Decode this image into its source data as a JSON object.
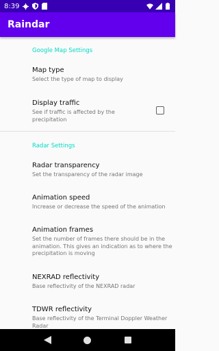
{
  "status_bar": {
    "time": "8:39",
    "icons_left": [
      "gear-icon",
      "shield-icon",
      "sim-card-icon"
    ],
    "icons_right": [
      "wifi-icon",
      "signal-icon",
      "battery-icon"
    ]
  },
  "app_bar": {
    "title": "Raindar"
  },
  "sections": [
    {
      "header": "Google Map Settings",
      "items": [
        {
          "title": "Map type",
          "summary": "Select the type of map to display"
        },
        {
          "title": "Display traffic",
          "summary": "See if traffic is affected by the precipitation",
          "checkbox": {
            "checked": false
          }
        }
      ]
    },
    {
      "header": "Radar Settings",
      "items": [
        {
          "title": "Radar transparency",
          "summary": "Set the transparency of the radar image"
        },
        {
          "title": "Animation speed",
          "summary": "Increase or decrease the speed of the animation"
        },
        {
          "title": "Animation frames",
          "summary": "Set the number of frames there should be in the animation. This gives an indication as to where the precipitation is moving"
        },
        {
          "title": "NEXRAD reflectivity",
          "summary": "Base reflectivity of the NEXRAD radar"
        },
        {
          "title": "TDWR reflectivity",
          "summary": "Base reflectivity of the Terminal Doppler Weather Radar"
        }
      ]
    }
  ],
  "nav_bar": {
    "buttons": [
      "back-icon",
      "home-icon",
      "recents-icon"
    ]
  },
  "colors": {
    "status_bar": "#3700b3",
    "app_bar": "#6200ee",
    "category_accent": "#03dac5",
    "background": "#fafafa"
  }
}
